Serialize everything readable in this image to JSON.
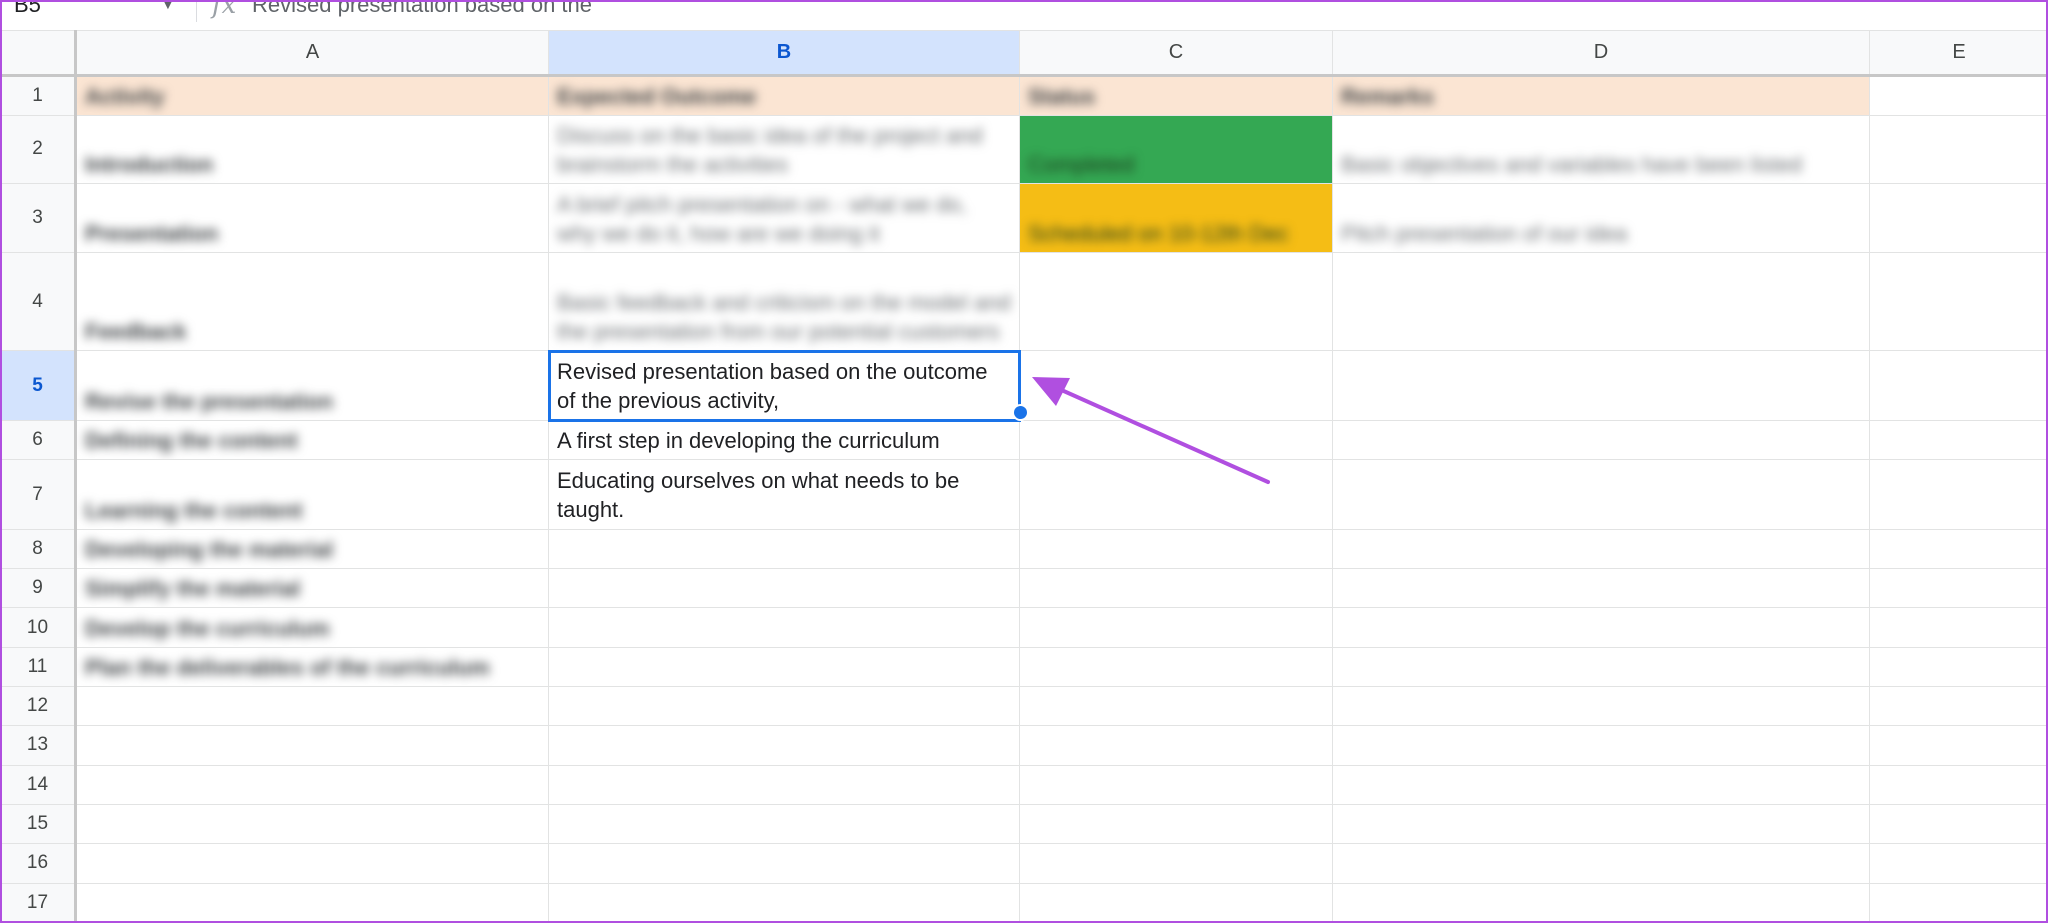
{
  "formula_bar": {
    "name_box": "B5",
    "fx_symbol": "fx",
    "value": "Revised presentation based on the"
  },
  "columns": [
    "A",
    "B",
    "C",
    "D",
    "E"
  ],
  "selected_column": "B",
  "rows": [
    "1",
    "2",
    "3",
    "4",
    "5",
    "6",
    "7",
    "8",
    "9",
    "10",
    "11",
    "12",
    "13",
    "14",
    "15",
    "16",
    "17"
  ],
  "selected_row": "5",
  "header": {
    "a": "Activity",
    "b": "Expected Outcome",
    "c": "Status",
    "d": "Remarks"
  },
  "cells": {
    "a2": "Introduction",
    "b2": "Discuss on the basic idea of the project and brainstorm the activities",
    "c2": "Completed",
    "d2": "Basic objectives and variables have been listed",
    "a3": "Presentation",
    "b3": "A brief pitch presentation on - what we do, why we do it, how are we doing it",
    "c3": "Scheduled on 10-12th Dec",
    "d3": "Pitch presentation of our idea",
    "a4": "Feedback",
    "b4": "Basic feedback and criticism on the model and the presentation from our potential customers",
    "a5": "Revise the presentation",
    "b5": "Revised presentation based on the outcome of the previous activity,",
    "a6": "Defining the content",
    "b6": "A first step in developing the curriculum",
    "a7": "Learning the content",
    "b7": "Educating ourselves on what needs to be taught.",
    "a8": "Developing the material",
    "a9": "Simplify the material",
    "a10": "Develop the curriculum",
    "a11": "Plan the deliverables of the curriculum"
  },
  "colors": {
    "accent": "#1a73e8",
    "header_fill": "#fbe5d3",
    "status_completed": "#34a853",
    "status_scheduled": "#f5bd15",
    "annotation_arrow": "#b04fe0"
  }
}
